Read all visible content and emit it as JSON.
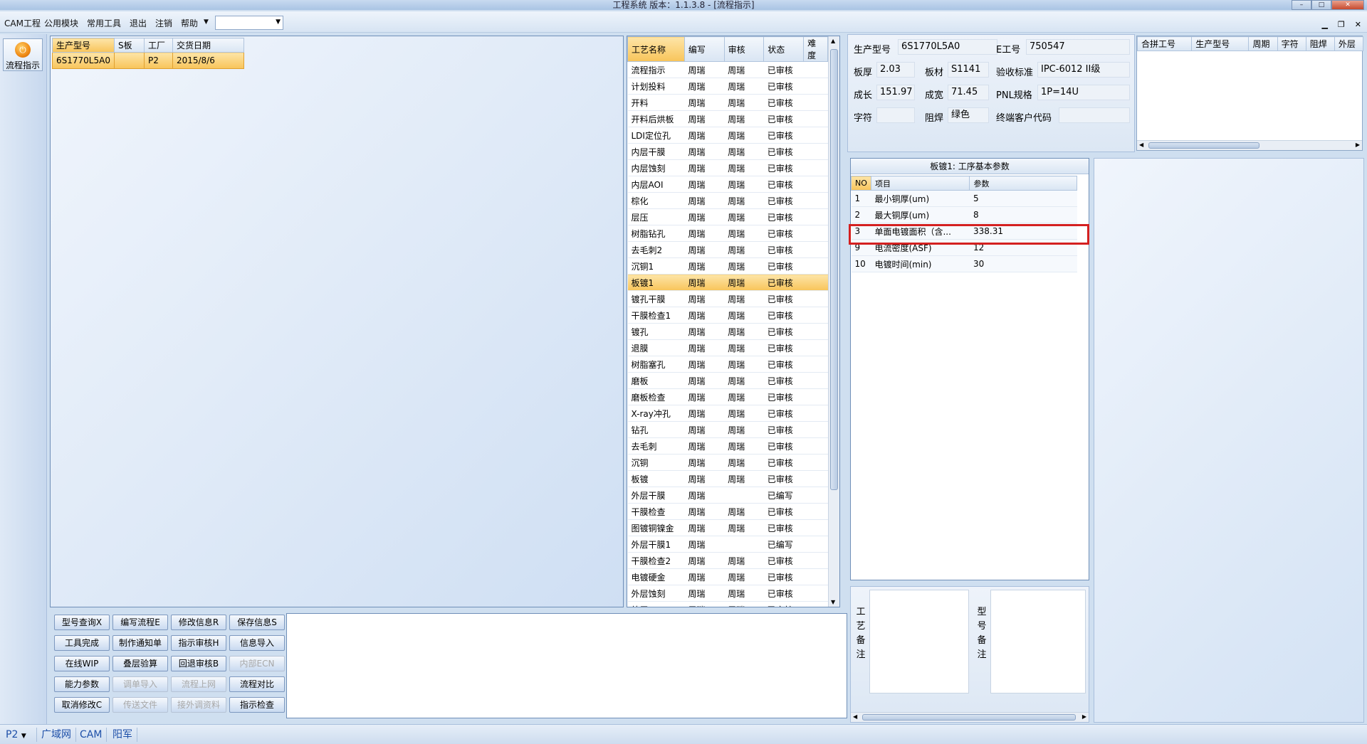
{
  "window": {
    "title": "工程系统   版本：1.1.3.8 - [流程指示]"
  },
  "menu": {
    "items": [
      "CAM工程",
      "公用模块",
      "常用工具",
      "退出",
      "注销",
      "帮助"
    ],
    "dropdown_value": ""
  },
  "sidebar": {
    "button_label": "流程指示"
  },
  "product_table": {
    "headers": [
      "生产型号",
      "S板",
      "工厂",
      "交货日期"
    ],
    "rows": [
      [
        "6S1770L5A0",
        "",
        "P2",
        "2015/8/6"
      ]
    ]
  },
  "process_table": {
    "headers": [
      "工艺名称",
      "编写",
      "审核",
      "状态",
      "难度"
    ],
    "rows": [
      [
        "流程指示",
        "周瑞",
        "周瑞",
        "已审核",
        ""
      ],
      [
        "计划投料",
        "周瑞",
        "周瑞",
        "已审核",
        ""
      ],
      [
        "开料",
        "周瑞",
        "周瑞",
        "已审核",
        ""
      ],
      [
        "开料后烘板",
        "周瑞",
        "周瑞",
        "已审核",
        ""
      ],
      [
        "LDI定位孔",
        "周瑞",
        "周瑞",
        "已审核",
        ""
      ],
      [
        "内层干膜",
        "周瑞",
        "周瑞",
        "已审核",
        ""
      ],
      [
        "内层蚀刻",
        "周瑞",
        "周瑞",
        "已审核",
        ""
      ],
      [
        "内层AOI",
        "周瑞",
        "周瑞",
        "已审核",
        ""
      ],
      [
        "棕化",
        "周瑞",
        "周瑞",
        "已审核",
        ""
      ],
      [
        "层压",
        "周瑞",
        "周瑞",
        "已审核",
        ""
      ],
      [
        "树脂钻孔",
        "周瑞",
        "周瑞",
        "已审核",
        ""
      ],
      [
        "去毛刺2",
        "周瑞",
        "周瑞",
        "已审核",
        ""
      ],
      [
        "沉铜1",
        "周瑞",
        "周瑞",
        "已审核",
        ""
      ],
      [
        "板镀1",
        "周瑞",
        "周瑞",
        "已审核",
        ""
      ],
      [
        "镀孔干膜",
        "周瑞",
        "周瑞",
        "已审核",
        ""
      ],
      [
        "干膜检查1",
        "周瑞",
        "周瑞",
        "已审核",
        ""
      ],
      [
        "镀孔",
        "周瑞",
        "周瑞",
        "已审核",
        ""
      ],
      [
        "退膜",
        "周瑞",
        "周瑞",
        "已审核",
        ""
      ],
      [
        "树脂塞孔",
        "周瑞",
        "周瑞",
        "已审核",
        ""
      ],
      [
        "磨板",
        "周瑞",
        "周瑞",
        "已审核",
        ""
      ],
      [
        "磨板检查",
        "周瑞",
        "周瑞",
        "已审核",
        ""
      ],
      [
        "X-ray冲孔",
        "周瑞",
        "周瑞",
        "已审核",
        ""
      ],
      [
        "钻孔",
        "周瑞",
        "周瑞",
        "已审核",
        ""
      ],
      [
        "去毛刺",
        "周瑞",
        "周瑞",
        "已审核",
        ""
      ],
      [
        "沉铜",
        "周瑞",
        "周瑞",
        "已审核",
        ""
      ],
      [
        "板镀",
        "周瑞",
        "周瑞",
        "已审核",
        ""
      ],
      [
        "外层干膜",
        "周瑞",
        "",
        "已编写",
        ""
      ],
      [
        "干膜检查",
        "周瑞",
        "周瑞",
        "已审核",
        ""
      ],
      [
        "图镀铜镍金",
        "周瑞",
        "周瑞",
        "已审核",
        ""
      ],
      [
        "外层干膜1",
        "周瑞",
        "",
        "已编写",
        ""
      ],
      [
        "干膜检查2",
        "周瑞",
        "周瑞",
        "已审核",
        ""
      ],
      [
        "电镀硬金",
        "周瑞",
        "周瑞",
        "已审核",
        ""
      ],
      [
        "外层蚀刻",
        "周瑞",
        "周瑞",
        "已审核",
        ""
      ],
      [
        "外层AOI",
        "周瑞",
        "周瑞",
        "已审核",
        ""
      ]
    ],
    "selected_index": 13
  },
  "buttons": [
    [
      "型号查询X",
      "编写流程E",
      "修改信息R",
      "保存信息S"
    ],
    [
      "工具完成",
      "制作通知单",
      "指示审核H",
      "信息导入"
    ],
    [
      "在线WIP",
      "叠层验算",
      "回退审核B",
      "内部ECN"
    ],
    [
      "能力参数",
      "调单导入",
      "流程上网",
      "流程对比"
    ],
    [
      "取消修改C",
      "传送文件",
      "接外调资料",
      "指示检查"
    ]
  ],
  "buttons_disabled": [
    "内部ECN",
    "调单导入",
    "流程上网",
    "传送文件",
    "接外调资料"
  ],
  "info": {
    "prod_label": "生产型号",
    "prod_value": "6S1770L5A0",
    "eno_label": "E工号",
    "eno_value": "750547",
    "thick_label": "板厚",
    "thick_value": "2.03",
    "material_label": "板材",
    "material_value": "S1141",
    "standard_label": "验收标准",
    "standard_value": "IPC-6012 II级",
    "length_label": "成长",
    "length_value": "151.97",
    "width_label": "成宽",
    "width_value": "71.45",
    "pnl_label": "PNL规格",
    "pnl_value": "1P=14U",
    "char_label": "字符",
    "char_value": "",
    "mask_label": "阻焊",
    "mask_value": "绿色",
    "customer_label": "终端客户代码",
    "customer_value": ""
  },
  "merge_table": {
    "headers": [
      "合拼工号",
      "生产型号",
      "周期",
      "字符",
      "阻焊",
      "外层"
    ]
  },
  "params": {
    "caption": "板镀1: 工序基本参数",
    "headers": [
      "NO",
      "项目",
      "参数"
    ],
    "rows": [
      [
        "1",
        "最小铜厚(um)",
        "5"
      ],
      [
        "2",
        "最大铜厚(um)",
        "8"
      ],
      [
        "3",
        "单面电镀面积（含...",
        "338.31"
      ],
      [
        "9",
        "电流密度(ASF)",
        "12"
      ],
      [
        "10",
        "电镀时间(min)",
        "30"
      ]
    ],
    "highlighted_index": 2
  },
  "remarks": {
    "process_label": "工艺备注",
    "model_label": "型号备注"
  },
  "status": {
    "plant": "P2",
    "network": "广域网",
    "dept": "CAM",
    "user": "阳军"
  },
  "colors": {
    "selection": "#f8c45a",
    "highlight_box": "#d42020",
    "chrome": "#cfdff0"
  }
}
